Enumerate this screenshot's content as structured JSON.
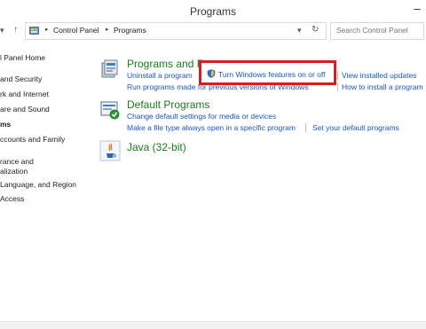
{
  "window": {
    "title": "Programs",
    "minimize_glyph": "–"
  },
  "toolbar": {
    "back_icon": "back-arrow-icon",
    "up_icon": "up-arrow-icon",
    "dropdown_icon": "chevron-down-icon",
    "refresh_icon": "refresh-icon"
  },
  "breadcrumb": {
    "separator": "▸",
    "items": [
      "Control Panel",
      "Programs"
    ]
  },
  "search": {
    "placeholder": "Search Control Panel"
  },
  "sidebar": {
    "items": [
      {
        "label": "l Panel Home",
        "active": false
      },
      {
        "label": "and Security",
        "active": false
      },
      {
        "label": "rk and Internet",
        "active": false
      },
      {
        "label": "are and Sound",
        "active": false
      },
      {
        "label": "ms",
        "active": true
      },
      {
        "label": "ccounts and Family",
        "active": false
      },
      {
        "label": "rance and",
        "active": false
      },
      {
        "label": "alization",
        "active": false
      },
      {
        "label": "Language, and Region",
        "active": false
      },
      {
        "label": "Access",
        "active": false
      }
    ]
  },
  "categories": {
    "programs_features": {
      "title": "Programs and Features",
      "links": [
        "Uninstall a program",
        "Turn Windows features on or off",
        "View installed updates",
        "Run programs made for previous versions of Windows",
        "How to install a program"
      ]
    },
    "default_programs": {
      "title": "Default Programs",
      "links": [
        "Change default settings for media or devices",
        "Make a file type always open in a specific program",
        "Set your default programs"
      ]
    },
    "java": {
      "title": "Java (32-bit)"
    }
  },
  "colors": {
    "category_title": "#1a7b1a",
    "link": "#1a56b8",
    "highlight_box": "#d31f1f"
  }
}
